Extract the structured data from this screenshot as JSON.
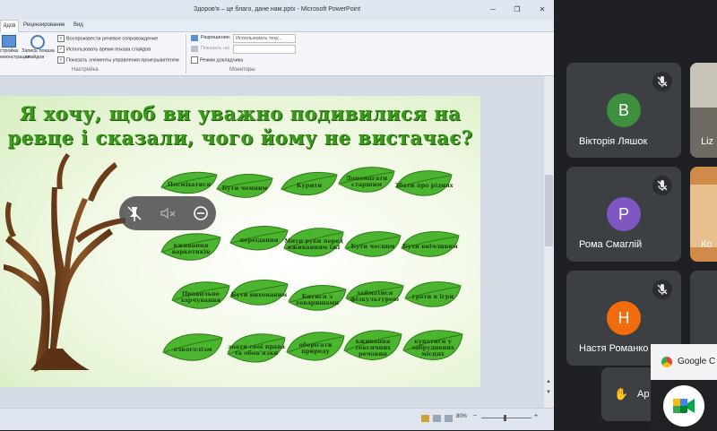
{
  "ppt": {
    "window_title": "Здоров'я – це благо, дане нам.pptx - Microsoft PowerPoint",
    "tabs": [
      "йдов",
      "Рецензирование",
      "Вид"
    ],
    "ribbon": {
      "setup_btn": "стройка",
      "setup_btn2": "емонстрации",
      "record_btn": "Запись показа",
      "record_btn2": "слайдов",
      "checkboxes": [
        "Воспроизвести речевое сопровождение",
        "Использовать время показа слайдов",
        "Показать элементы управления проигрывателем"
      ],
      "group_label": "Настройка",
      "resolution_label": "Разрешение:",
      "resolution_value": "Использовать теку...",
      "show_on_label": "Показать на:",
      "presenter_view": "Режим докладчика",
      "monitors_label": "Мониторы"
    },
    "slide": {
      "title_line1": "Я хочу, щоб ви уважно подивилися на",
      "title_line2": "ревце і сказали, чого йому не вистачає?",
      "leaves": [
        "Посміхатися",
        "Бути чемним",
        "Курити",
        "Допомагати старшим",
        "Збати про рідних",
        "вживання наркотиків",
        "переїдання",
        "Мити руки перед вживанням їжі",
        "Бути чесним",
        "Бути ввічливим",
        "Правильне харчування",
        "Бути вихованим",
        "Битися з товаришами",
        "займатися фізкультурою",
        "грати в ігри",
        "алкоголізм",
        "знати свої права та обов'язки",
        "оберігати природу",
        "вживання токсичних речовин",
        "купатися у забруднених місцях"
      ]
    },
    "status": {
      "zoom": "80%"
    }
  },
  "meet": {
    "participants": [
      {
        "initial": "В",
        "name": "Вікторія Ляшок",
        "color": "#3d8f3d"
      },
      {
        "initial": "Р",
        "name": "Рома Смаглій",
        "color": "#7e57c2"
      },
      {
        "initial": "Н",
        "name": "Настя Романко",
        "color": "#f26c0d"
      }
    ],
    "side_names": [
      "Liz",
      "Ко"
    ],
    "raise_hand_label": "Ар",
    "chrome_label": "Google C"
  }
}
